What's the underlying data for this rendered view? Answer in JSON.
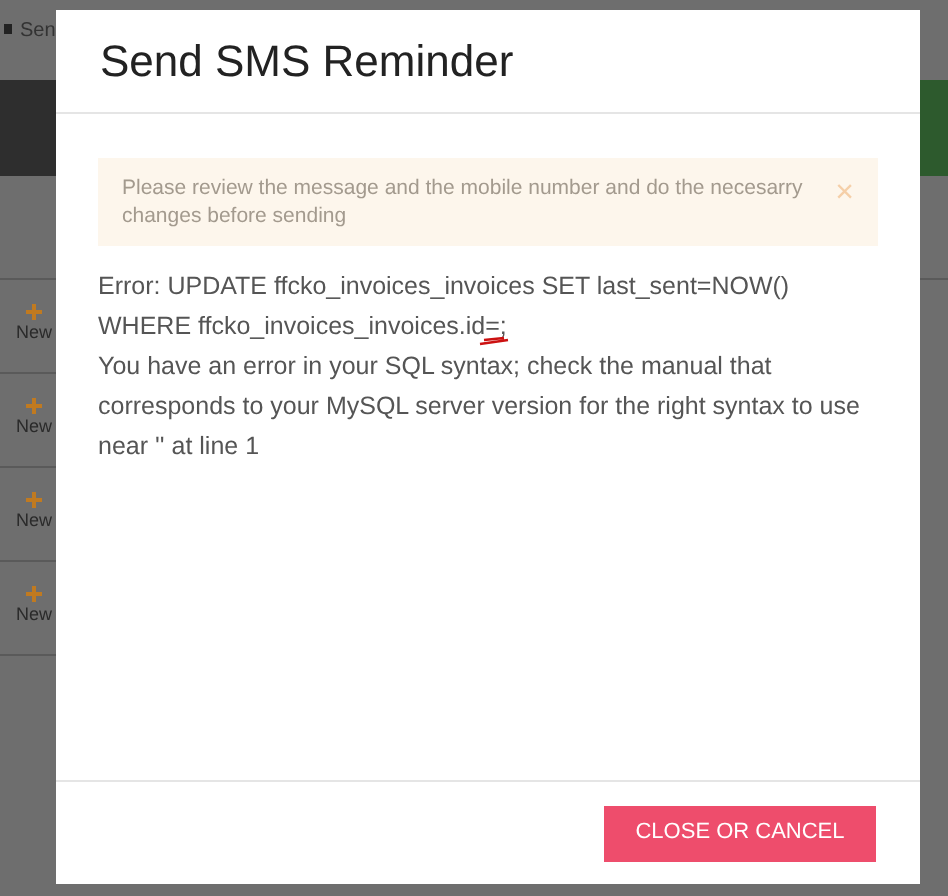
{
  "background": {
    "tab_label": "Sen",
    "items": [
      {
        "label": "New"
      },
      {
        "label": "New"
      },
      {
        "label": "New"
      },
      {
        "label": "New"
      }
    ]
  },
  "dialog": {
    "title": "Send SMS Reminder",
    "alert": {
      "text": "Please review the message and the mobile number and do the necesarry changes before sending",
      "dismiss": "×"
    },
    "error": {
      "query": "Error: UPDATE ffcko_invoices_invoices SET last_sent=NOW() WHERE ffcko_invoices_invoices.id=;",
      "message": "You have an error in your SQL syntax; check the manual that corresponds to your MySQL server version for the right syntax to use near '' at line 1"
    },
    "buttons": [
      {
        "label": "CLOSE OR CANCEL",
        "kind": "danger"
      }
    ]
  }
}
